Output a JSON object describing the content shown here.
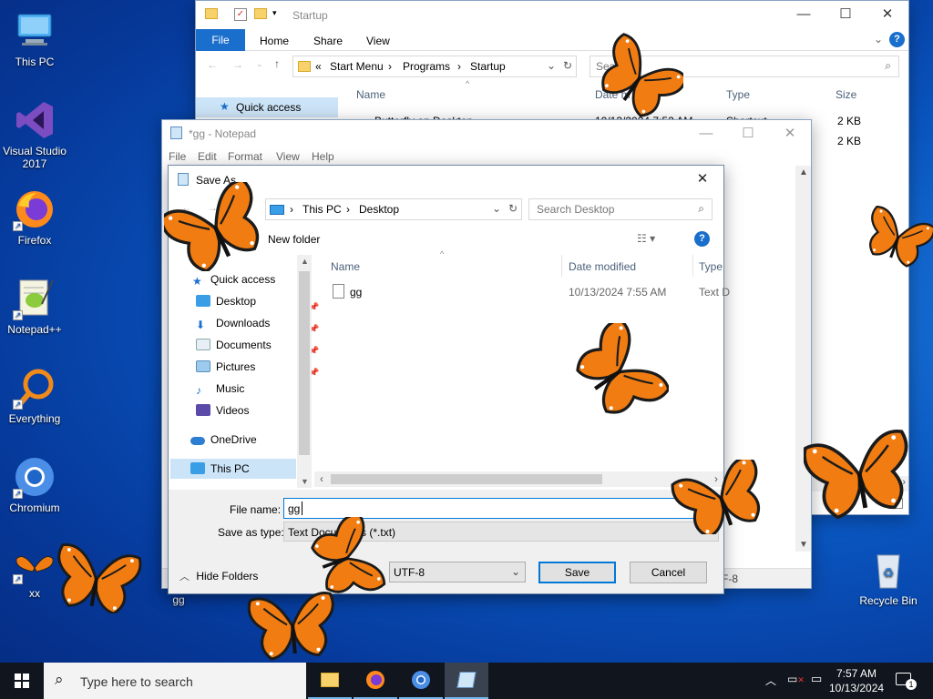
{
  "desktop": {
    "icons": [
      {
        "label": "This PC"
      },
      {
        "label": "Visual Studio 2017"
      },
      {
        "label": "Firefox"
      },
      {
        "label": "Notepad++"
      },
      {
        "label": "Everything"
      },
      {
        "label": "Chromium"
      },
      {
        "label": "xx"
      },
      {
        "label": "gg"
      },
      {
        "label": "Recycle Bin"
      }
    ]
  },
  "explorer": {
    "title": "Startup",
    "ribbon_tabs": [
      "File",
      "Home",
      "Share",
      "View"
    ],
    "address": {
      "prefix": "«",
      "segments": [
        "Start Menu",
        "Programs",
        "Startup"
      ]
    },
    "search_placeholder": "Search S",
    "columns": [
      "Name",
      "Date m",
      "Type",
      "Size"
    ],
    "nav_quick_access": "Quick access",
    "rows": [
      {
        "name": "Butterfly on Desktop",
        "date": "10/13/2024 7:52 AM",
        "type": "Shortcut",
        "size": "2 KB"
      },
      {
        "name": "",
        "date": "",
        "type": "",
        "size": "2 KB"
      }
    ]
  },
  "notepad": {
    "title": "*gg - Notepad",
    "menu": [
      "File",
      "Edit",
      "Format",
      "View",
      "Help"
    ],
    "status_fragment": "F-8"
  },
  "saveas": {
    "title": "Save As",
    "path": [
      "This PC",
      "Desktop"
    ],
    "search_placeholder": "Search Desktop",
    "new_folder": "New folder",
    "nav": [
      {
        "label": "Quick access",
        "pinned": false
      },
      {
        "label": "Desktop",
        "pinned": true
      },
      {
        "label": "Downloads",
        "pinned": true
      },
      {
        "label": "Documents",
        "pinned": true
      },
      {
        "label": "Pictures",
        "pinned": true
      },
      {
        "label": "Music",
        "pinned": false
      },
      {
        "label": "Videos",
        "pinned": false
      },
      {
        "label": "OneDrive",
        "pinned": false
      },
      {
        "label": "This PC",
        "pinned": false
      }
    ],
    "columns": [
      "Name",
      "Date modified",
      "Type"
    ],
    "files": [
      {
        "name": "gg",
        "date": "10/13/2024 7:55 AM",
        "type": "Text D"
      }
    ],
    "file_name_label": "File name:",
    "file_name_value": "gg",
    "save_type_label": "Save as type:",
    "save_type_value": "Text Documents (*.txt)",
    "hide_folders": "Hide Folders",
    "encoding": "UTF-8",
    "save": "Save",
    "cancel": "Cancel"
  },
  "taskbar": {
    "search_placeholder": "Type here to search",
    "time": "7:57 AM",
    "date": "10/13/2024",
    "notifications": "1"
  },
  "colors": {
    "accent": "#0063b1",
    "taskbar": "#10151e",
    "butterfly": "#f07c12"
  }
}
